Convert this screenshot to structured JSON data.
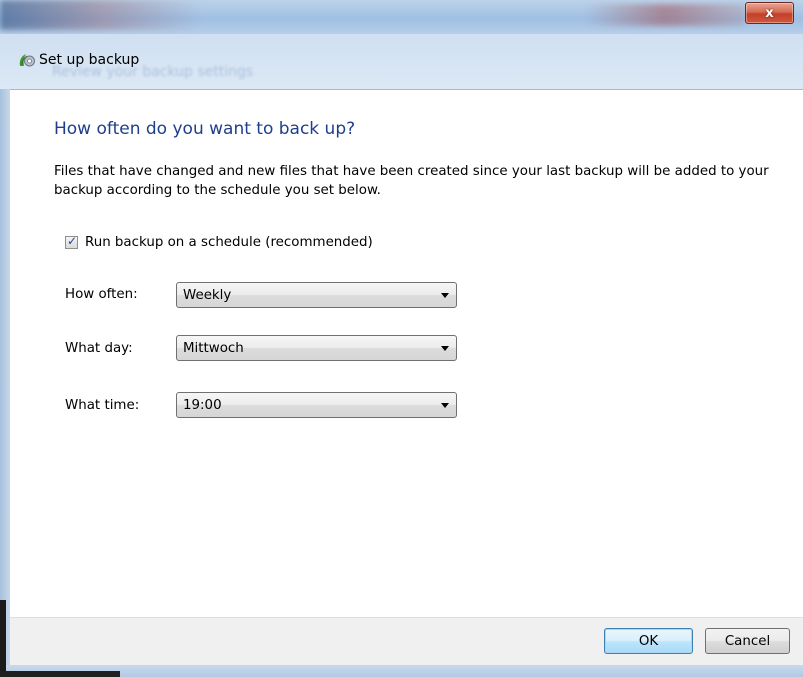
{
  "window": {
    "title": "Set up backup",
    "ghost_header": "Review your backup settings",
    "close_glyph": "x"
  },
  "main": {
    "instruction": "How often do you want to back up?",
    "description": "Files that have changed and new files that have been created since your last backup will be added to your backup according to the schedule you set below.",
    "schedule_checkbox": {
      "label": "Run backup on a schedule (recommended)",
      "checked": true,
      "check_glyph": "✓"
    },
    "fields": {
      "how_often": {
        "label": "How often:",
        "value": "Weekly"
      },
      "what_day": {
        "label": "What day:",
        "value": "Mittwoch"
      },
      "what_time": {
        "label": "What time:",
        "value": "19:00"
      }
    }
  },
  "footer": {
    "ok_label": "OK",
    "cancel_label": "Cancel"
  },
  "icons": {
    "app": "backup-icon",
    "close": "close-icon",
    "dropdown": "chevron-down-icon"
  },
  "colors": {
    "instruction": "#1e3f8c",
    "close_button": "#c2412a",
    "default_button_border": "#3c7fb1"
  }
}
